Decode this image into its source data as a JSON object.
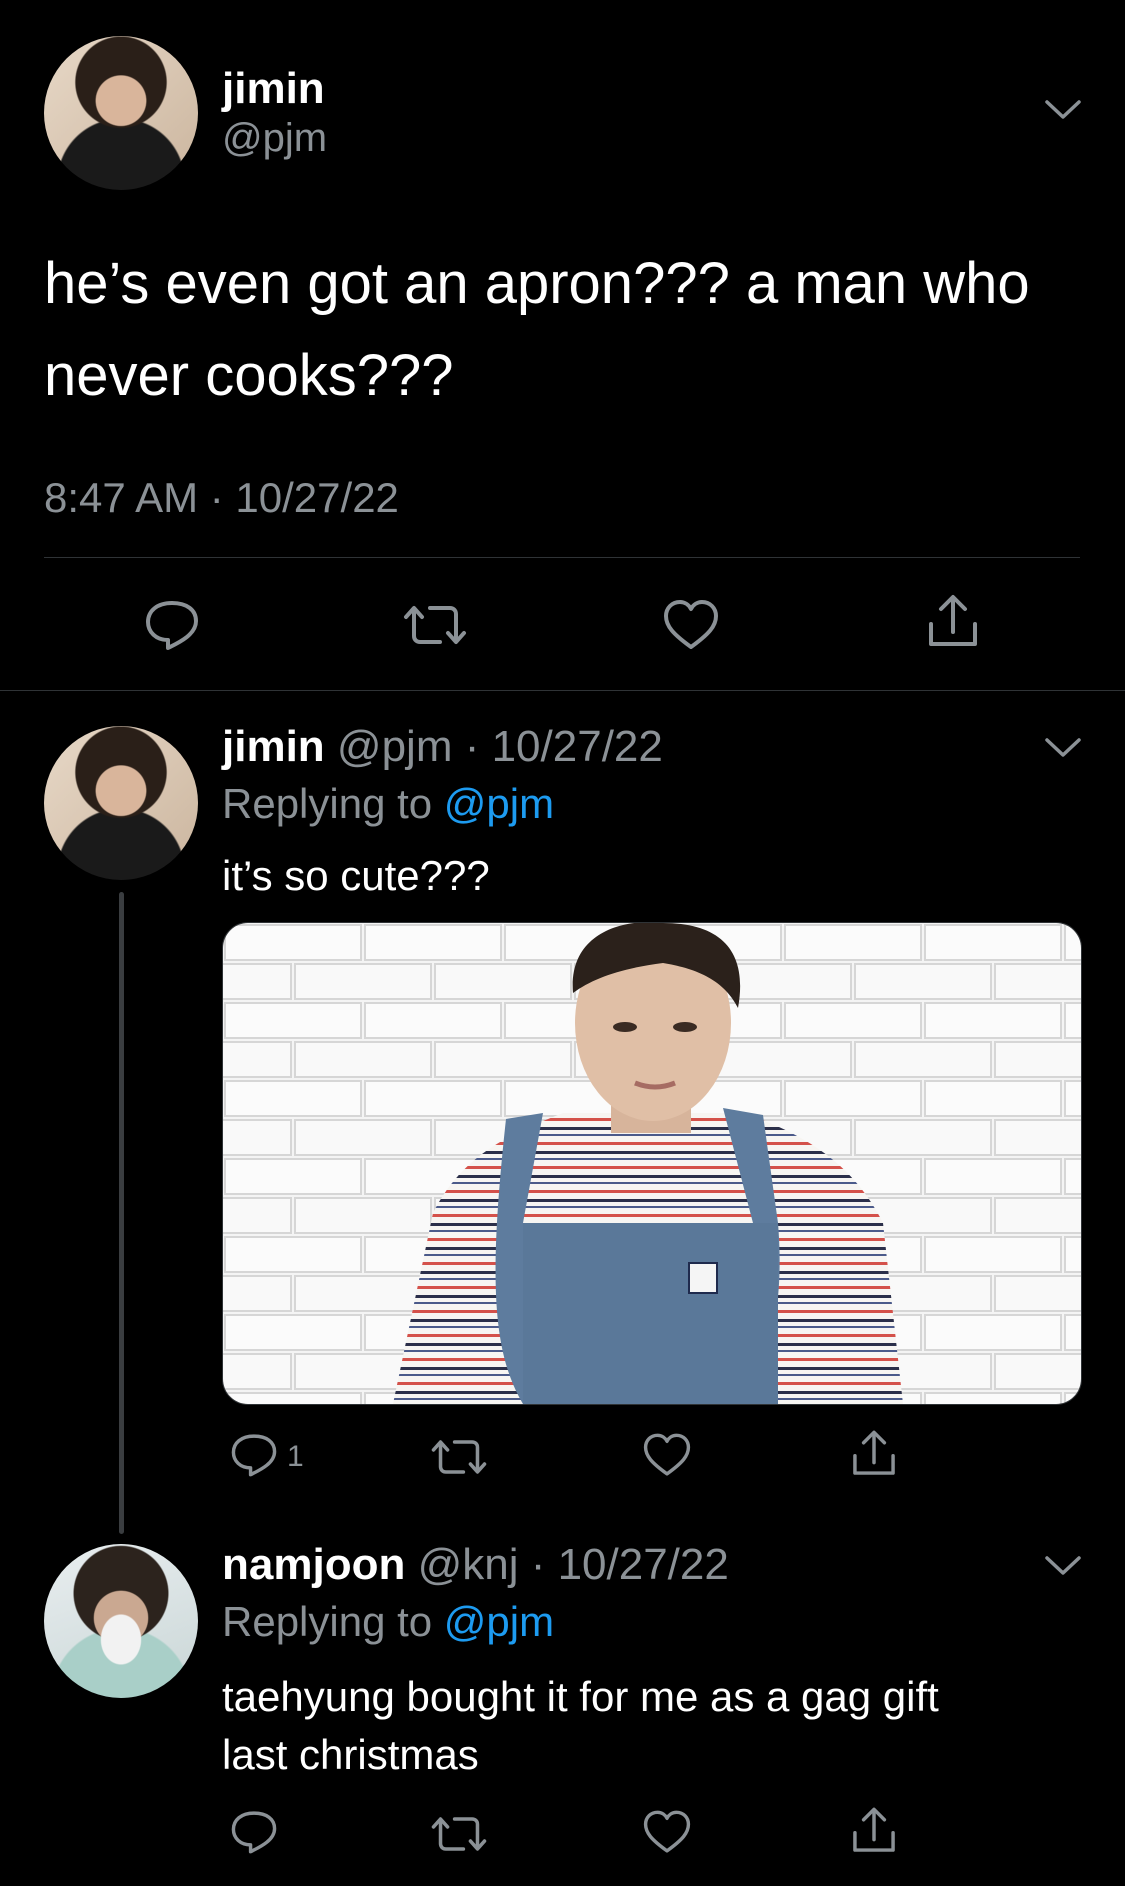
{
  "main_tweet": {
    "author_name": "jimin",
    "author_handle": "@pjm",
    "text_line1": "he’s even got an apron??? a man who",
    "text_line2": "never cooks???",
    "timestamp": "8:47 AM · 10/27/22"
  },
  "reply1": {
    "author_name": "jimin",
    "author_meta": "@pjm · 10/27/22",
    "replying_prefix": "Replying to ",
    "replying_handle": "@pjm",
    "text": "it’s so cute???",
    "reply_count": "1"
  },
  "reply2": {
    "author_name": "namjoon",
    "author_meta": "@knj · 10/27/22",
    "replying_prefix": "Replying to ",
    "replying_handle": "@pjm",
    "text_line1": "taehyung bought it for me as a gag gift",
    "text_line2": "last christmas"
  },
  "icons": [
    "chevron-down-icon",
    "reply-icon",
    "retweet-icon",
    "like-icon",
    "share-icon"
  ],
  "colors": {
    "background": "#000000",
    "secondary_text": "#8b9196",
    "link": "#1d9bf0",
    "divider": "#2f3336"
  }
}
